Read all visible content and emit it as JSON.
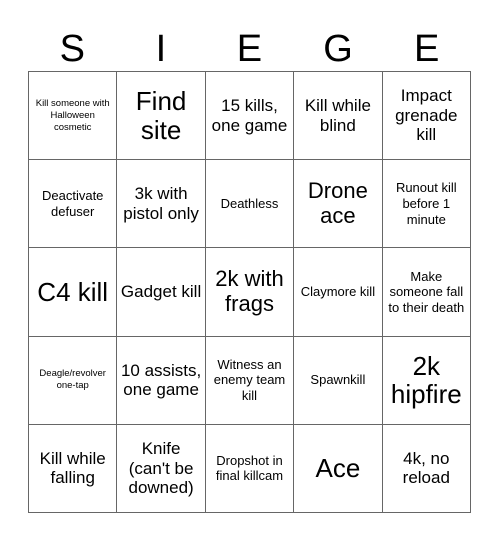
{
  "header": {
    "letters": [
      "S",
      "I",
      "E",
      "G",
      "E"
    ]
  },
  "grid": {
    "columns": 5,
    "rows": 5,
    "border_color": "#666666",
    "background_color": "#ffffff",
    "text_color": "#000000",
    "cells": [
      {
        "text": "Kill someone with Halloween cosmetic",
        "size": "xs"
      },
      {
        "text": "Find site",
        "size": "xl"
      },
      {
        "text": "15 kills, one game",
        "size": "md"
      },
      {
        "text": "Kill while blind",
        "size": "md"
      },
      {
        "text": "Impact grenade kill",
        "size": "md"
      },
      {
        "text": "Deactivate defuser",
        "size": "sm"
      },
      {
        "text": "3k with pistol only",
        "size": "md"
      },
      {
        "text": "Deathless",
        "size": "sm"
      },
      {
        "text": "Drone ace",
        "size": "lg"
      },
      {
        "text": "Runout kill before 1 minute",
        "size": "sm"
      },
      {
        "text": "C4 kill",
        "size": "xl"
      },
      {
        "text": "Gadget kill",
        "size": "md"
      },
      {
        "text": "2k with frags",
        "size": "lg"
      },
      {
        "text": "Claymore kill",
        "size": "sm"
      },
      {
        "text": "Make someone fall to their death",
        "size": "sm"
      },
      {
        "text": "Deagle/revolver one-tap",
        "size": "xs"
      },
      {
        "text": "10 assists, one game",
        "size": "md"
      },
      {
        "text": "Witness an enemy team kill",
        "size": "sm"
      },
      {
        "text": "Spawnkill",
        "size": "sm"
      },
      {
        "text": "2k hipfire",
        "size": "xl"
      },
      {
        "text": "Kill while falling",
        "size": "md"
      },
      {
        "text": "Knife (can't be downed)",
        "size": "md"
      },
      {
        "text": "Dropshot in final killcam",
        "size": "sm"
      },
      {
        "text": "Ace",
        "size": "xl"
      },
      {
        "text": "4k, no reload",
        "size": "md"
      }
    ]
  }
}
